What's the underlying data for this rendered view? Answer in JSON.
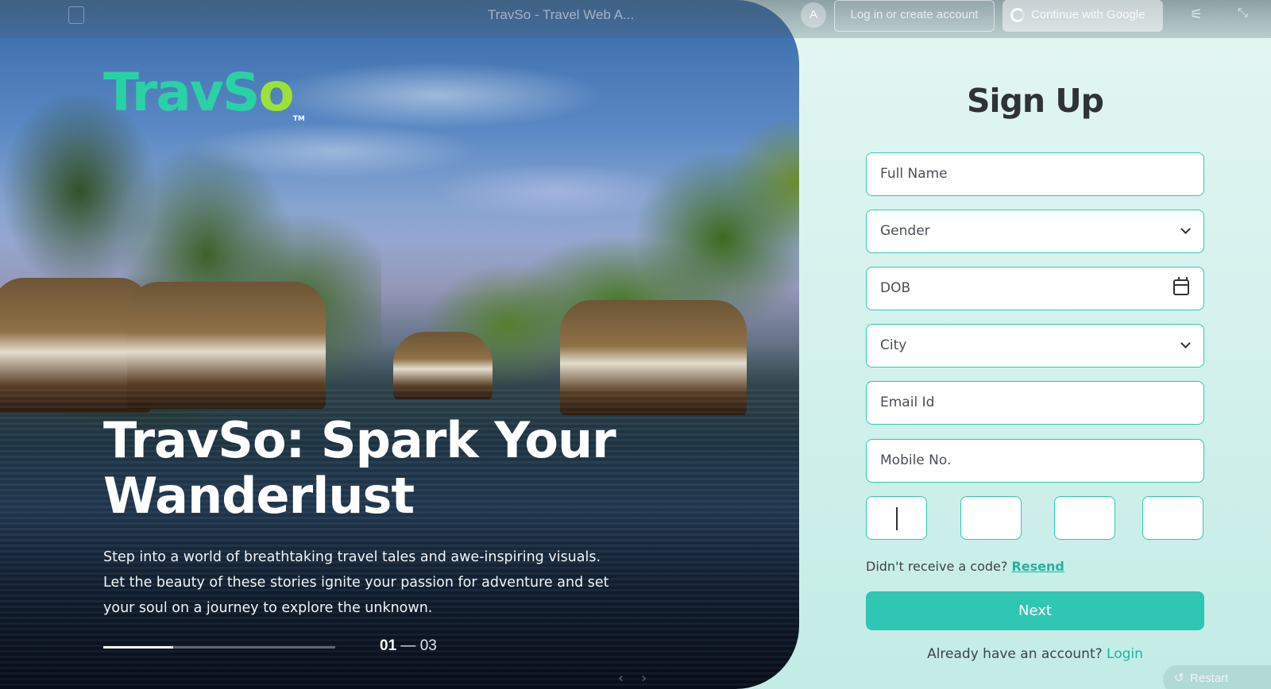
{
  "topbar": {
    "title": "TravSo - Travel Web A...",
    "avatar_initial": "A",
    "login_label": "Log in or create account",
    "google_label": "Continue with Google",
    "restart_label": "Restart"
  },
  "hero": {
    "logo_main": "TravS",
    "logo_o": "o",
    "logo_tm": "TM",
    "headline": "TravSo: Spark Your Wanderlust",
    "subtext": "Step into a world of breathtaking travel tales and awe-inspiring visuals. Let the beauty of these stories ignite your passion for adventure and set your soul on a journey to explore the unknown.",
    "slide_current": "01",
    "slide_separator": "—",
    "slide_total": "03",
    "progress_fraction": 0.3
  },
  "form": {
    "title": "Sign Up",
    "full_name_placeholder": "Full Name",
    "gender_placeholder": "Gender",
    "dob_placeholder": "DOB",
    "city_placeholder": "City",
    "email_placeholder": "Email Id",
    "mobile_placeholder": "Mobile No.",
    "otp_prompt": "Didn't receive a code?",
    "resend_label": "Resend",
    "next_label": "Next",
    "already_text": "Already have an account?",
    "login_link": "Login"
  },
  "colors": {
    "accent": "#2fc6b4",
    "logo_green": "#2ad1a6",
    "logo_lime": "#9be238",
    "text_dark": "#2e3338"
  }
}
